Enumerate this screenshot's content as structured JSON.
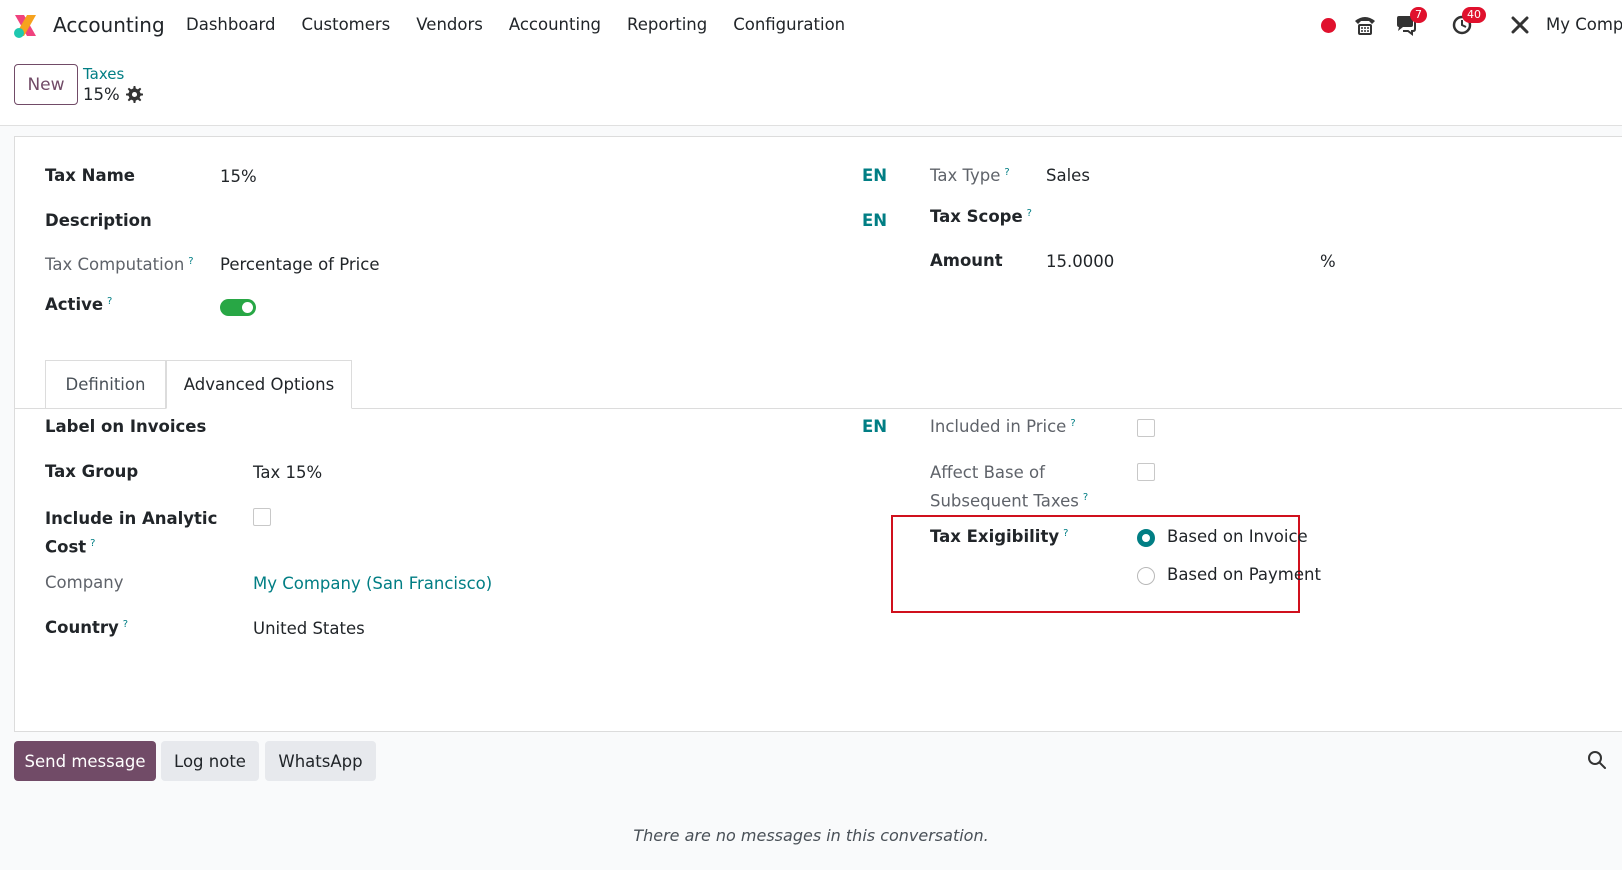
{
  "app": {
    "name": "Accounting"
  },
  "nav": {
    "items": [
      "Dashboard",
      "Customers",
      "Vendors",
      "Accounting",
      "Reporting",
      "Configuration"
    ]
  },
  "systray": {
    "messages_badge": "7",
    "activities_badge": "40",
    "company": "My Comp"
  },
  "control_panel": {
    "new_label": "New",
    "breadcrumb_parent": "Taxes",
    "breadcrumb_current": "15%"
  },
  "form": {
    "tax_name": {
      "label": "Tax Name",
      "value": "15%",
      "lang": "EN"
    },
    "description": {
      "label": "Description",
      "value": "",
      "lang": "EN"
    },
    "tax_computation": {
      "label": "Tax Computation",
      "value": "Percentage of Price"
    },
    "active": {
      "label": "Active",
      "value": true
    },
    "tax_type": {
      "label": "Tax Type",
      "value": "Sales"
    },
    "tax_scope": {
      "label": "Tax Scope",
      "value": ""
    },
    "amount": {
      "label": "Amount",
      "value": "15.0000",
      "unit": "%"
    }
  },
  "tabs": [
    {
      "label": "Definition",
      "active": false
    },
    {
      "label": "Advanced Options",
      "active": true
    }
  ],
  "advanced": {
    "label_on_invoices": {
      "label": "Label on Invoices",
      "lang": "EN"
    },
    "tax_group": {
      "label": "Tax Group",
      "value": "Tax 15%"
    },
    "include_analytic": {
      "label_line1": "Include in Analytic",
      "label_line2": "Cost",
      "checked": false
    },
    "company": {
      "label": "Company",
      "value": "My Company (San Francisco)"
    },
    "country": {
      "label": "Country",
      "value": "United States"
    },
    "included_in_price": {
      "label": "Included in Price",
      "checked": false
    },
    "affect_base": {
      "label_line1": "Affect Base of",
      "label_line2": "Subsequent Taxes",
      "checked": false
    },
    "tax_exigibility": {
      "label": "Tax Exigibility",
      "options": [
        {
          "label": "Based on Invoice",
          "selected": true
        },
        {
          "label": "Based on Payment",
          "selected": false
        }
      ]
    }
  },
  "chatter": {
    "send_message": "Send message",
    "log_note": "Log note",
    "whatsapp": "WhatsApp",
    "empty": "There are no messages in this conversation."
  },
  "colors": {
    "primary": "#714b67",
    "link": "#017e84",
    "toggle_on": "#28a745",
    "highlight": "#d0101d"
  }
}
